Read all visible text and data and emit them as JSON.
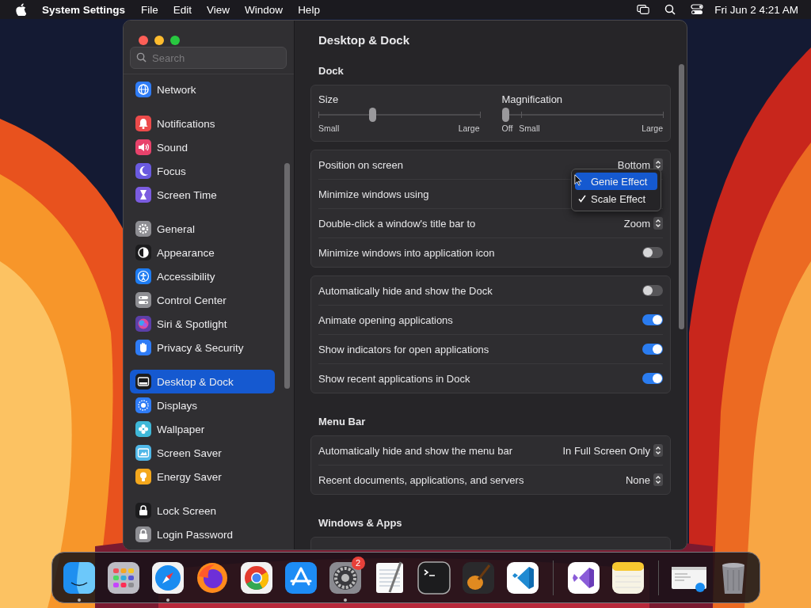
{
  "menubar": {
    "app_name": "System Settings",
    "menus": [
      "File",
      "Edit",
      "View",
      "Window",
      "Help"
    ],
    "clock": "Fri Jun 2  4:21 AM"
  },
  "sidebar": {
    "search": {
      "placeholder": "Search"
    },
    "groups": [
      [
        {
          "label": "Network",
          "color": "#2f7cf6",
          "selected": false
        }
      ],
      [
        {
          "label": "Notifications",
          "color": "#ec4b4b",
          "selected": false
        },
        {
          "label": "Sound",
          "color": "#e8426b",
          "selected": false
        },
        {
          "label": "Focus",
          "color": "#6a5ae0",
          "selected": false
        },
        {
          "label": "Screen Time",
          "color": "#7b5ce0",
          "selected": false
        }
      ],
      [
        {
          "label": "General",
          "color": "#8e8e93",
          "selected": false
        },
        {
          "label": "Appearance",
          "color": "#1c1c1e",
          "selected": false
        },
        {
          "label": "Accessibility",
          "color": "#1e7cf2",
          "selected": false
        },
        {
          "label": "Control Center",
          "color": "#8e8e93",
          "selected": false
        },
        {
          "label": "Siri & Spotlight",
          "color": "#5b3fa8",
          "selected": false
        },
        {
          "label": "Privacy & Security",
          "color": "#2f7cf6",
          "selected": false
        }
      ],
      [
        {
          "label": "Desktop & Dock",
          "color": "#1c1c1e",
          "selected": true
        },
        {
          "label": "Displays",
          "color": "#2f7cf6",
          "selected": false
        },
        {
          "label": "Wallpaper",
          "color": "#3fb8d8",
          "selected": false
        },
        {
          "label": "Screen Saver",
          "color": "#50b8e8",
          "selected": false
        },
        {
          "label": "Energy Saver",
          "color": "#f4a81d",
          "selected": false
        }
      ],
      [
        {
          "label": "Lock Screen",
          "color": "#1c1c1e",
          "selected": false
        },
        {
          "label": "Login Password",
          "color": "#8e8e93",
          "selected": false
        }
      ]
    ]
  },
  "content": {
    "title": "Desktop & Dock",
    "sections": [
      {
        "heading": "Dock",
        "cards": [
          {
            "kind": "sliders",
            "sliders": [
              {
                "label": "Size",
                "level": 0.33,
                "scale": [
                  "Small",
                  "Large"
                ]
              },
              {
                "label": "Magnification",
                "level": 0,
                "scale": [
                  "Off",
                  "Small",
                  "Large"
                ]
              }
            ]
          },
          {
            "kind": "rows",
            "rows": [
              {
                "kind": "popup",
                "label": "Position on screen",
                "value": "Bottom"
              },
              {
                "kind": "menu",
                "label": "Minimize windows using",
                "options": [
                  {
                    "label": "Genie Effect",
                    "highlighted": true,
                    "checked": false
                  },
                  {
                    "label": "Scale Effect",
                    "highlighted": false,
                    "checked": true
                  }
                ]
              },
              {
                "kind": "popup",
                "label": "Double-click a window's title bar to",
                "value": "Zoom"
              },
              {
                "kind": "toggle",
                "label": "Minimize windows into application icon",
                "on": false
              }
            ]
          },
          {
            "kind": "rows",
            "rows": [
              {
                "kind": "toggle",
                "label": "Automatically hide and show the Dock",
                "on": false
              },
              {
                "kind": "toggle",
                "label": "Animate opening applications",
                "on": true
              },
              {
                "kind": "toggle",
                "label": "Show indicators for open applications",
                "on": true
              },
              {
                "kind": "toggle",
                "label": "Show recent applications in Dock",
                "on": true
              }
            ]
          }
        ]
      },
      {
        "heading": "Menu Bar",
        "cards": [
          {
            "kind": "rows",
            "rows": [
              {
                "kind": "popup",
                "label": "Automatically hide and show the menu bar",
                "value": "In Full Screen Only"
              },
              {
                "kind": "popup",
                "label": "Recent documents, applications, and servers",
                "value": "None"
              }
            ]
          }
        ]
      },
      {
        "heading": "Windows & Apps",
        "cards": [
          {
            "kind": "rows"
          }
        ]
      }
    ]
  },
  "dock": [
    {
      "kind": "app",
      "running": true
    },
    {
      "kind": "app",
      "running": false
    },
    {
      "kind": "app",
      "running": true
    },
    {
      "kind": "app",
      "running": false
    },
    {
      "kind": "app",
      "running": false
    },
    {
      "kind": "app",
      "running": false
    },
    {
      "kind": "app",
      "running": true,
      "badge": "2"
    },
    {
      "kind": "app",
      "running": false
    },
    {
      "kind": "app",
      "running": false
    },
    {
      "kind": "app",
      "running": false
    },
    {
      "kind": "app",
      "running": false
    },
    {
      "kind": "separator"
    },
    {
      "kind": "app",
      "running": false
    },
    {
      "kind": "app",
      "running": false
    },
    {
      "kind": "separator"
    },
    {
      "kind": "app",
      "running": false
    },
    {
      "kind": "app",
      "running": false
    }
  ]
}
